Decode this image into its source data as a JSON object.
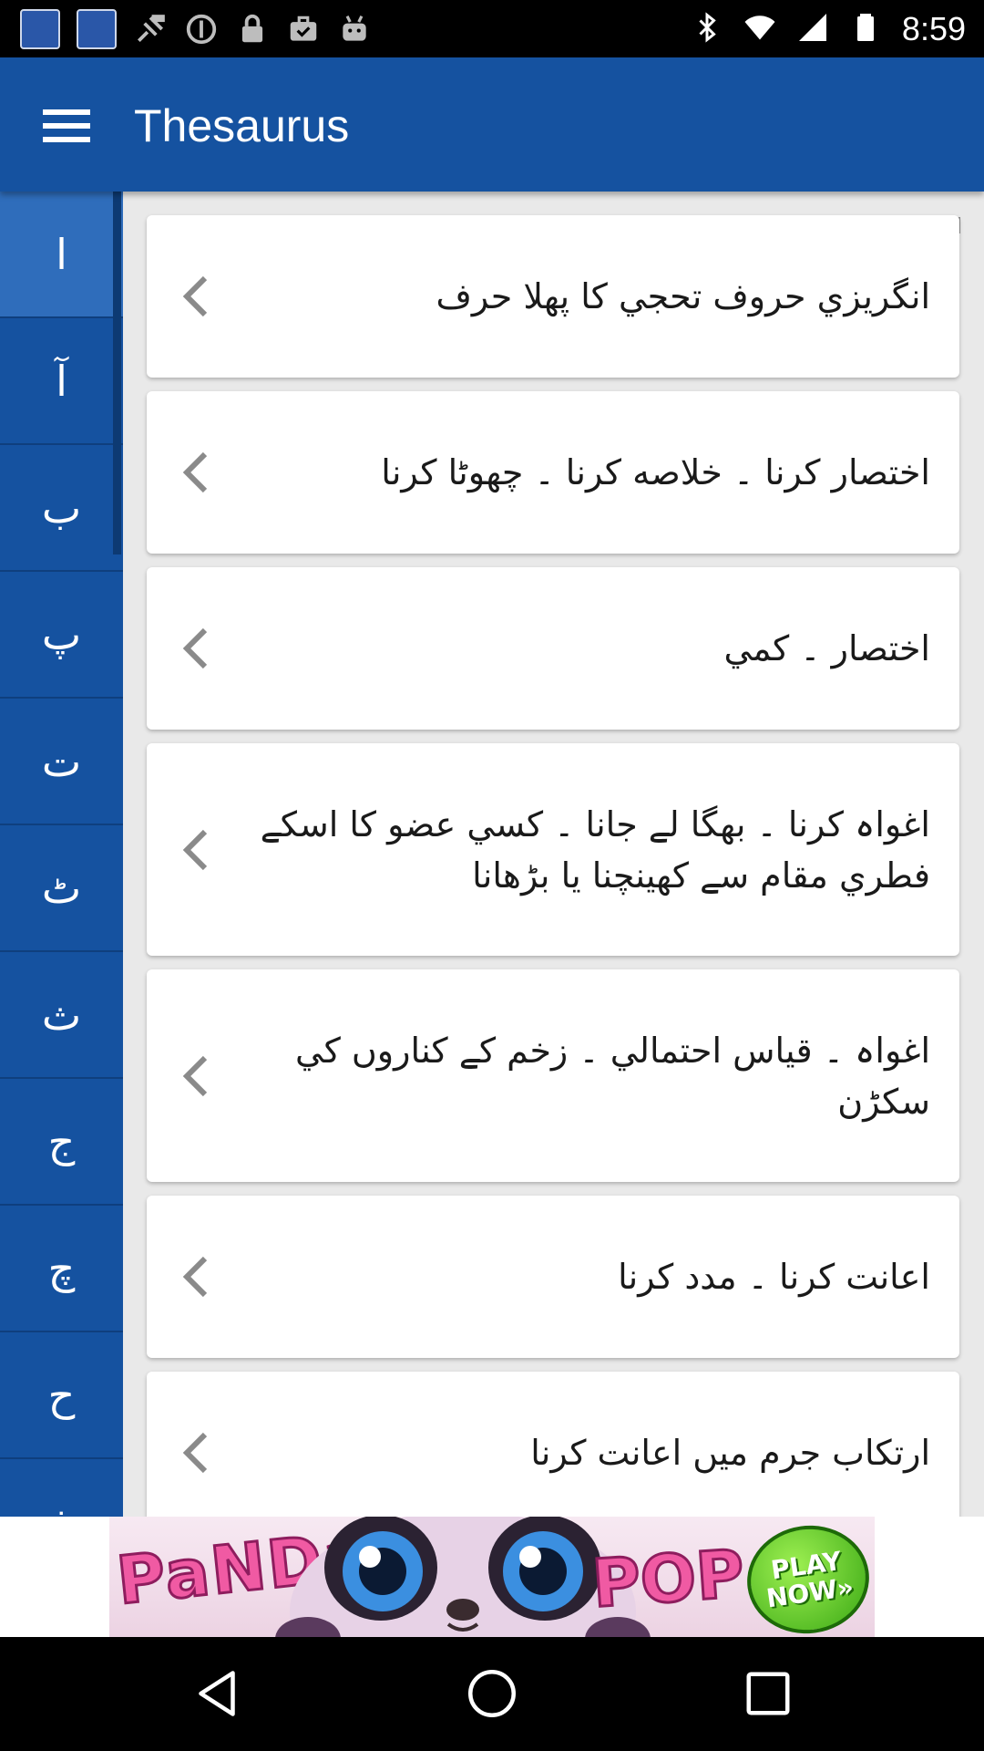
{
  "status_bar": {
    "time": "8:59",
    "app_icons": [
      "dictionary-app-icon",
      "dictionary-app-icon"
    ],
    "icons": [
      "fake-gps-icon",
      "info-icon",
      "lock-icon",
      "briefcase-check-icon",
      "android-icon",
      "bluetooth-icon",
      "wifi-icon",
      "signal-icon",
      "battery-icon"
    ]
  },
  "app_bar": {
    "title": "Thesaurus",
    "menu_icon": "menu-icon",
    "color": "#1552a0"
  },
  "letter_index": {
    "letters": [
      "ا",
      "آ",
      "ب",
      "پ",
      "ت",
      "ٹ",
      "ث",
      "ج",
      "چ",
      "ح",
      "خ"
    ],
    "active_index": 0
  },
  "entries": [
    {
      "text": "انگريزي حروف تحجي کا پهلا حرف"
    },
    {
      "text": "اختصار کرنا ۔ خلاصه کرنا ۔ چھوٹا کرنا"
    },
    {
      "text": "اختصار ۔ کمي"
    },
    {
      "text": "اغواہ کرنا ۔ بھگا لے جانا ۔ کسي عضو کا اسکے فطري مقام سے کھينچنا يا بڑھانا"
    },
    {
      "text": "اغواہ ۔ قياس احتمالي ۔ زخم کے کناروں کي سکڑن"
    },
    {
      "text": "اعانت کرنا ۔ مدد کرنا"
    },
    {
      "text": "ارتکاب جرم ميں اعانت کرنا"
    }
  ],
  "ad": {
    "word_left": "PaNDa",
    "word_right": "POP",
    "play_line1": "PLAY",
    "play_line2": "NOW»"
  },
  "nav_bar": {
    "icons": [
      "back-icon",
      "home-icon",
      "recents-icon"
    ]
  }
}
